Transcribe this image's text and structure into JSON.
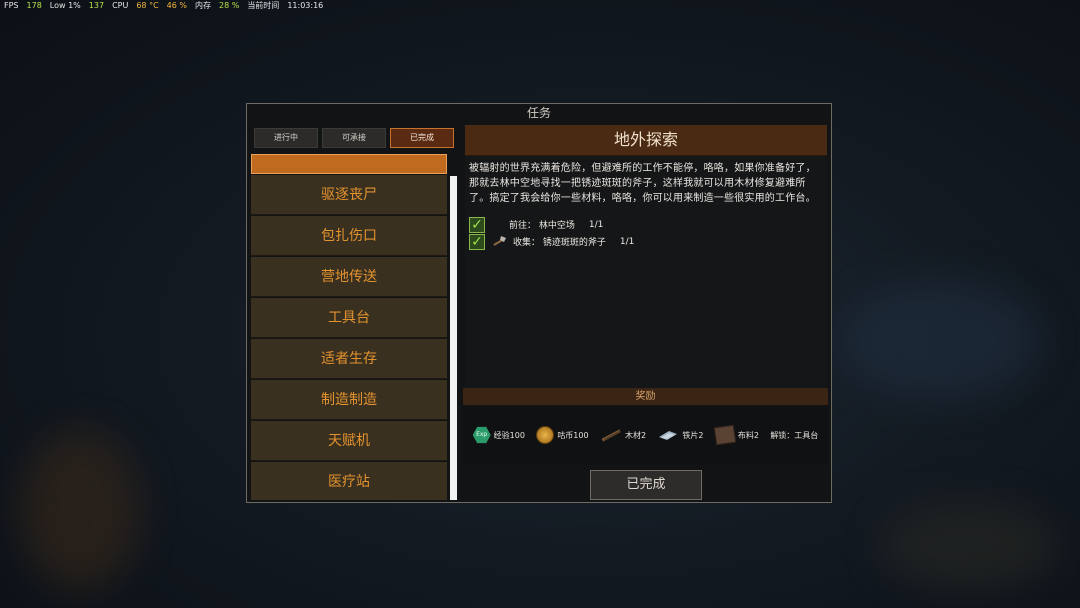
{
  "perf": {
    "fps_label": "FPS",
    "fps_value": "178",
    "low_label": "Low 1%",
    "low_value": "137",
    "cpu_label": "CPU",
    "cpu_temp": "68 °C",
    "cpu_pct": "46 %",
    "mem_label": "内存",
    "mem_pct": "28 %",
    "time_label": "当前时间",
    "time_value": "11:03:16"
  },
  "window": {
    "title": "任务"
  },
  "tabs": [
    {
      "label": "进行中",
      "active": false
    },
    {
      "label": "可承接",
      "active": false
    },
    {
      "label": "已完成",
      "active": true
    }
  ],
  "quest_list": [
    "驱逐丧尸",
    "包扎伤口",
    "营地传送",
    "工具台",
    "适者生存",
    "制造制造",
    "天赋机",
    "医疗站"
  ],
  "detail": {
    "title": "地外探索",
    "description": "被辐射的世界充满着危险，但避难所的工作不能停，咯咯，如果你准备好了，那就去林中空地寻找一把锈迹斑斑的斧子，这样我就可以用木材修复避难所了。搞定了我会给你一些材料，咯咯，你可以用来制造一些很实用的工作台。",
    "objectives": [
      {
        "text": "前往： 林中空场",
        "count": "1/1",
        "done": true,
        "icon": "none"
      },
      {
        "text": "收集： 锈迹斑斑的斧子",
        "count": "1/1",
        "done": true,
        "icon": "axe-icon"
      }
    ]
  },
  "reward": {
    "header": "奖励",
    "items": [
      {
        "icon": "exp-icon",
        "icon_text": "Exp",
        "label": "经验100"
      },
      {
        "icon": "coin-icon",
        "label": "咕币100"
      },
      {
        "icon": "wood-icon",
        "label": "木材2"
      },
      {
        "icon": "iron-icon",
        "label": "铁片2"
      },
      {
        "icon": "cloth-icon",
        "label": "布料2"
      },
      {
        "icon": "none",
        "label": "解锁：工具台"
      }
    ]
  },
  "complete_button": "已完成",
  "colors": {
    "accent": "#e3922e",
    "tab_active": "#5b2a12",
    "selected_bar": "#c06a20"
  }
}
